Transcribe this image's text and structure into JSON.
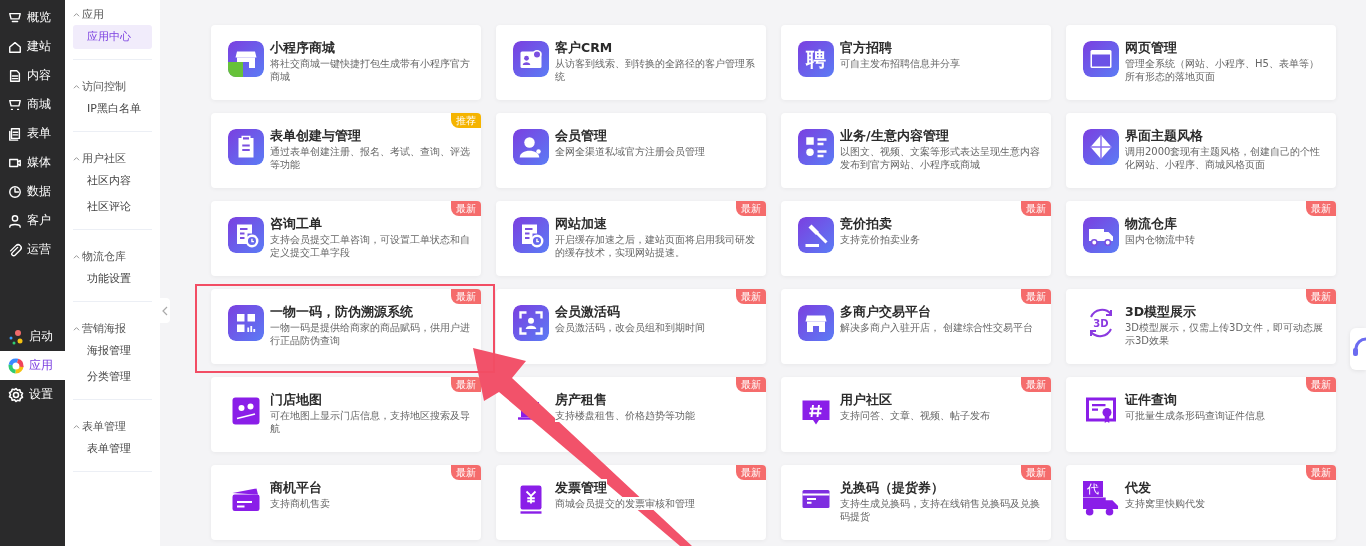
{
  "nav": [
    {
      "label": "概览",
      "selected": false
    },
    {
      "label": "建站",
      "selected": false
    },
    {
      "label": "内容",
      "selected": false
    },
    {
      "label": "商城",
      "selected": false
    },
    {
      "label": "表单",
      "selected": false
    },
    {
      "label": "媒体",
      "selected": false
    },
    {
      "label": "数据",
      "selected": false
    },
    {
      "label": "客户",
      "selected": false
    },
    {
      "label": "运营",
      "selected": false
    }
  ],
  "nav_bottom": [
    {
      "label": "启动",
      "selected": false
    },
    {
      "label": "应用",
      "selected": true
    },
    {
      "label": "设置",
      "selected": false
    }
  ],
  "subnav": [
    {
      "heading": "应用",
      "items": [
        {
          "label": "应用中心",
          "selected": true
        }
      ]
    },
    {
      "heading": "访问控制",
      "items": [
        {
          "label": "IP黑白名单",
          "selected": false
        }
      ]
    },
    {
      "heading": "用户社区",
      "items": [
        {
          "label": "社区内容",
          "selected": false
        },
        {
          "label": "社区评论",
          "selected": false
        }
      ]
    },
    {
      "heading": "物流仓库",
      "items": [
        {
          "label": "功能设置",
          "selected": false
        }
      ]
    },
    {
      "heading": "营销海报",
      "items": [
        {
          "label": "海报管理",
          "selected": false
        },
        {
          "label": "分类管理",
          "selected": false
        }
      ]
    },
    {
      "heading": "表单管理",
      "items": [
        {
          "label": "表单管理",
          "selected": false
        }
      ]
    }
  ],
  "apps": [
    {
      "title": "小程序商城",
      "desc": "将社交商城一键快捷打包生成带有小程序官方商城"
    },
    {
      "title": "客户CRM",
      "desc": "从访客到线索、到转换的全路径的客户管理系统"
    },
    {
      "title": "官方招聘",
      "desc": "可自主发布招聘信息并分享",
      "icon_text": "聘"
    },
    {
      "title": "网页管理",
      "desc": "管理全系统（网站、小程序、H5、表单等）所有形态的落地页面"
    },
    {
      "title": "表单创建与管理",
      "desc": "通过表单创建注册、报名、考试、查询、评选等功能",
      "badge": {
        "text": "推荐",
        "kind": "recommend"
      }
    },
    {
      "title": "会员管理",
      "desc": "全网全渠道私域官方注册会员管理"
    },
    {
      "title": "业务/生意内容管理",
      "desc": "以图文、视频、文案等形式表达呈现生意内容发布到官方网站、小程序或商城"
    },
    {
      "title": "界面主题风格",
      "desc": "调用2000套现有主题风格，创建自己的个性化网站、小程序、商城风格页面"
    },
    {
      "title": "咨询工单",
      "desc": "支持会员提交工单咨询，可设置工单状态和自定义提交工单字段",
      "badge": {
        "text": "最新",
        "kind": "new"
      }
    },
    {
      "title": "网站加速",
      "desc": "开启缓存加速之后，建站页面将启用我司研发的缓存技术，实现网站提速。",
      "badge": {
        "text": "最新",
        "kind": "new"
      }
    },
    {
      "title": "竞价拍卖",
      "desc": "支持竞价拍卖业务",
      "badge": {
        "text": "最新",
        "kind": "new"
      }
    },
    {
      "title": "物流仓库",
      "desc": "国内仓物流中转",
      "badge": {
        "text": "最新",
        "kind": "new"
      }
    },
    {
      "title": "一物一码，防伪溯源系统",
      "desc": "一物一码是提供给商家的商品赋码，供用户进行正品防伪查询",
      "badge": {
        "text": "最新",
        "kind": "new"
      },
      "highlighted": true
    },
    {
      "title": "会员激活码",
      "desc": "会员激活码，改会员组和到期时间",
      "badge": {
        "text": "最新",
        "kind": "new"
      }
    },
    {
      "title": "多商户交易平台",
      "desc": "解决多商户入驻开店， 创建综合性交易平台",
      "badge": {
        "text": "最新",
        "kind": "new"
      }
    },
    {
      "title": "3D模型展示",
      "desc": "3D模型展示，仅需上传3D文件，即可动态展示3D效果",
      "badge": {
        "text": "最新",
        "kind": "new"
      },
      "icon_text": "3D"
    },
    {
      "title": "门店地图",
      "desc": "可在地图上显示门店信息，支持地区搜索及导航",
      "badge": {
        "text": "最新",
        "kind": "new"
      }
    },
    {
      "title": "房产租售",
      "desc": "支持楼盘租售、价格趋势等功能",
      "badge": {
        "text": "最新",
        "kind": "new"
      }
    },
    {
      "title": "用户社区",
      "desc": "支持问答、文章、视频、帖子发布",
      "badge": {
        "text": "最新",
        "kind": "new"
      }
    },
    {
      "title": "证件查询",
      "desc": "可批量生成条形码查询证件信息",
      "badge": {
        "text": "最新",
        "kind": "new"
      }
    },
    {
      "title": "商机平台",
      "desc": "支持商机售卖",
      "badge": {
        "text": "最新",
        "kind": "new"
      }
    },
    {
      "title": "发票管理",
      "desc": "商城会员提交的发票审核和管理",
      "badge": {
        "text": "最新",
        "kind": "new"
      }
    },
    {
      "title": "兑换码（提货券）",
      "desc": "支持生成兑换码，支持在线销售兑换码及兑换码提货",
      "badge": {
        "text": "最新",
        "kind": "new"
      }
    },
    {
      "title": "代发",
      "desc": "支持窝里快购代发",
      "badge": {
        "text": "最新",
        "kind": "new"
      },
      "icon_text": "代"
    }
  ]
}
